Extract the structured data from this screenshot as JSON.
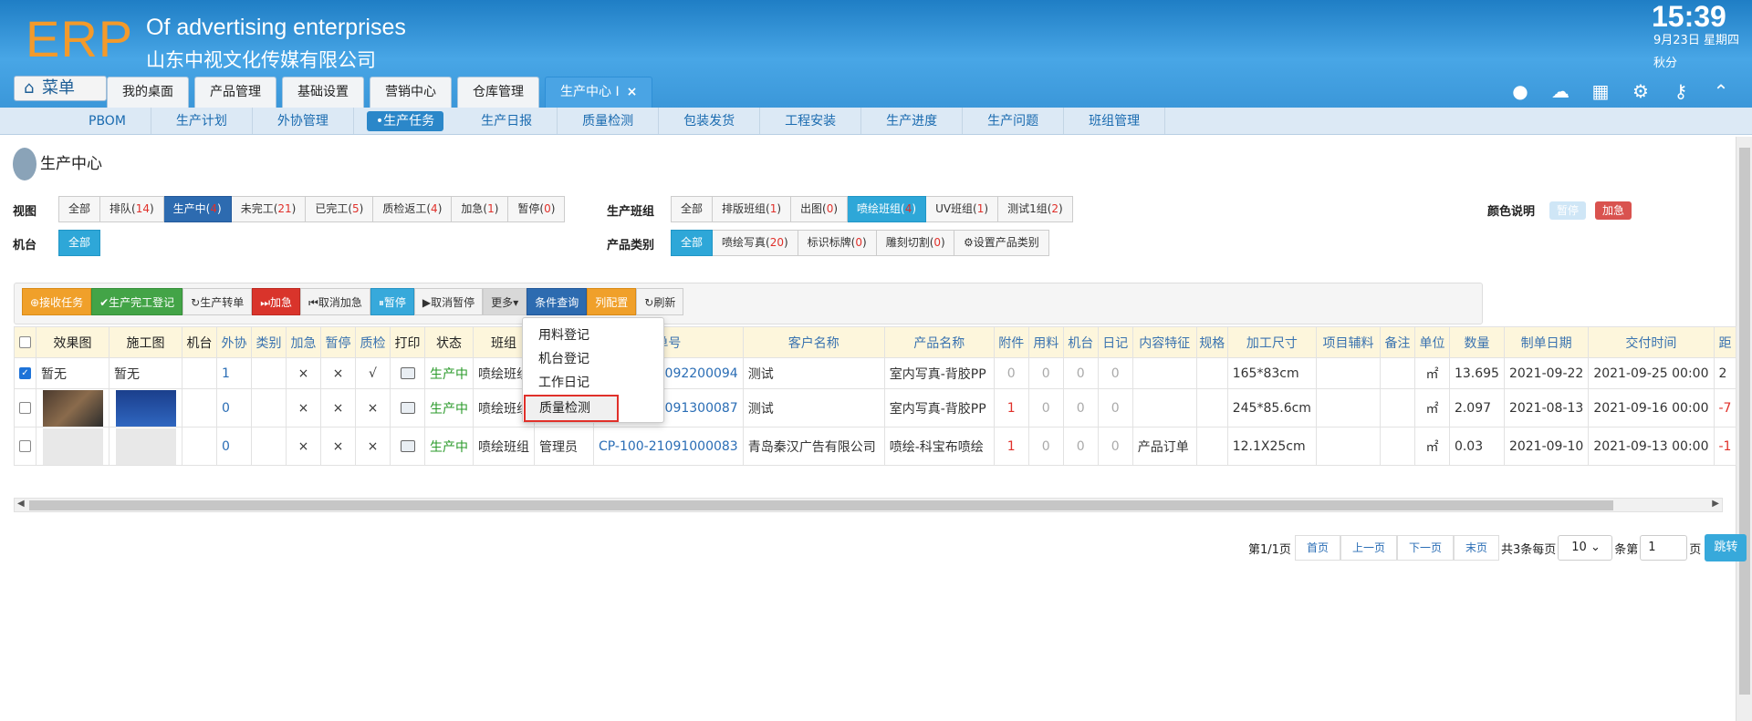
{
  "header": {
    "logo": "ERP",
    "company_en": "Of advertising enterprises",
    "company_cn": "山东中视文化传媒有限公司",
    "time": "15:39",
    "date": "9月23日 星期四",
    "user": "秋分"
  },
  "menu_label": "菜单",
  "tabs": [
    {
      "label": "我的桌面"
    },
    {
      "label": "产品管理"
    },
    {
      "label": "基础设置"
    },
    {
      "label": "营销中心"
    },
    {
      "label": "仓库管理"
    },
    {
      "label": "生产中心 I",
      "close": "×"
    }
  ],
  "subnav": [
    "PBOM",
    "生产计划",
    "外协管理",
    "•生产任务",
    "生产日报",
    "质量检测",
    "包装发货",
    "工程安装",
    "生产进度",
    "生产问题",
    "班组管理"
  ],
  "page_title": "生产中心",
  "filters": {
    "view_label": "视图",
    "views": [
      {
        "t": "全部",
        "n": ""
      },
      {
        "t": "排队(",
        "n": "14",
        ")": ")"
      },
      {
        "t": "生产中(",
        "n": "4"
      },
      {
        "t": "未完工(",
        "n": "21"
      },
      {
        "t": "已完工(",
        "n": "5"
      },
      {
        "t": "质检返工(",
        "n": "4"
      },
      {
        "t": "加急(",
        "n": "1"
      },
      {
        "t": "暂停(",
        "n": "0"
      }
    ],
    "machine_label": "机台",
    "machine_all": "全部",
    "team_label": "生产班组",
    "teams": [
      {
        "t": "全部",
        "n": ""
      },
      {
        "t": "排版班组(",
        "n": "1"
      },
      {
        "t": "出图(",
        "n": "0"
      },
      {
        "t": "喷绘班组(",
        "n": "4"
      },
      {
        "t": "UV班组(",
        "n": "1"
      },
      {
        "t": "测试1组(",
        "n": "2"
      }
    ],
    "category_label": "产品类别",
    "categories": [
      {
        "t": "全部",
        "n": ""
      },
      {
        "t": "喷绘写真(",
        "n": "20"
      },
      {
        "t": "标识标牌(",
        "n": "0"
      },
      {
        "t": "雕刻切割(",
        "n": "0"
      }
    ],
    "set_category": "设置产品类别",
    "color_label": "颜色说明",
    "tag_pause": "暂停",
    "tag_urgent": "加急"
  },
  "toolbar": [
    "接收任务",
    "生产完工登记",
    "生产转单",
    "加急",
    "取消加急",
    "暂停",
    "取消暂停",
    "更多",
    "条件查询",
    "列配置",
    "刷新"
  ],
  "dropdown": [
    "用料登记",
    "机台登记",
    "工作日记",
    "质量检测"
  ],
  "columns": [
    "效果图",
    "施工图",
    "机台",
    "外协",
    "类别",
    "加急",
    "暂停",
    "质检",
    "打印",
    "状态",
    "班组",
    "操作员",
    "单号",
    "客户名称",
    "产品名称",
    "附件",
    "用料",
    "机台",
    "日记",
    "内容特征",
    "规格",
    "加工尺寸",
    "项目辅料",
    "备注",
    "单位",
    "数量",
    "制单日期",
    "交付时间",
    "距"
  ],
  "rows": [
    {
      "checked": true,
      "eff": "暂无",
      "con": "暂无",
      "wx": "1",
      "urg": "×",
      "pause": "×",
      "qc": "√",
      "status": "生产中",
      "team": "喷绘班组",
      "op": "",
      "no": "CP-100-21092200094",
      "cust": "测试",
      "prod": "室内写真-背胶PP",
      "att": "0",
      "mat": "0",
      "mach": "0",
      "log": "0",
      "feat": "",
      "spec": "",
      "size": "165*83cm",
      "aux": "",
      "note": "",
      "unit": "㎡",
      "qty": "13.695",
      "date": "2021-09-22",
      "due": "2021-09-25 00:00",
      "dist": "2"
    },
    {
      "checked": false,
      "eff": "",
      "con": "",
      "wx": "0",
      "urg": "×",
      "pause": "×",
      "qc": "×",
      "status": "生产中",
      "team": "喷绘班组",
      "op": "",
      "no": "CP-100-21091300087",
      "cust": "测试",
      "prod": "室内写真-背胶PP",
      "att": "1",
      "mat": "0",
      "mach": "0",
      "log": "0",
      "feat": "",
      "spec": "",
      "size": "245*85.6cm",
      "aux": "",
      "note": "",
      "unit": "㎡",
      "qty": "2.097",
      "date": "2021-08-13",
      "due": "2021-09-16 00:00",
      "dist": "-7"
    },
    {
      "checked": false,
      "eff": "",
      "con": "",
      "wx": "0",
      "urg": "×",
      "pause": "×",
      "qc": "×",
      "status": "生产中",
      "team": "喷绘班组",
      "op": "管理员",
      "no": "CP-100-21091000083",
      "cust": "青岛秦汉广告有限公司",
      "prod": "喷绘-科宝布喷绘",
      "att": "1",
      "mat": "0",
      "mach": "0",
      "log": "0",
      "feat": "产品订单",
      "spec": "",
      "size": "12.1X25cm",
      "aux": "",
      "note": "",
      "unit": "㎡",
      "qty": "0.03",
      "date": "2021-09-10",
      "due": "2021-09-13 00:00",
      "dist": "-1"
    }
  ],
  "pager": {
    "info": "第1/1页",
    "first": "首页",
    "prev": "上一页",
    "next": "下一页",
    "last": "末页",
    "total": "共3条每页",
    "size": "10",
    "per": "条第",
    "page": "1",
    "unit": "页",
    "jump": "跳转"
  },
  "colors": {
    "accent": "#2d6bb0",
    "header": "#3b97d9",
    "orange": "#f0a02a",
    "green": "#43a447",
    "red": "#d9342b",
    "cyan": "#37a9db"
  }
}
